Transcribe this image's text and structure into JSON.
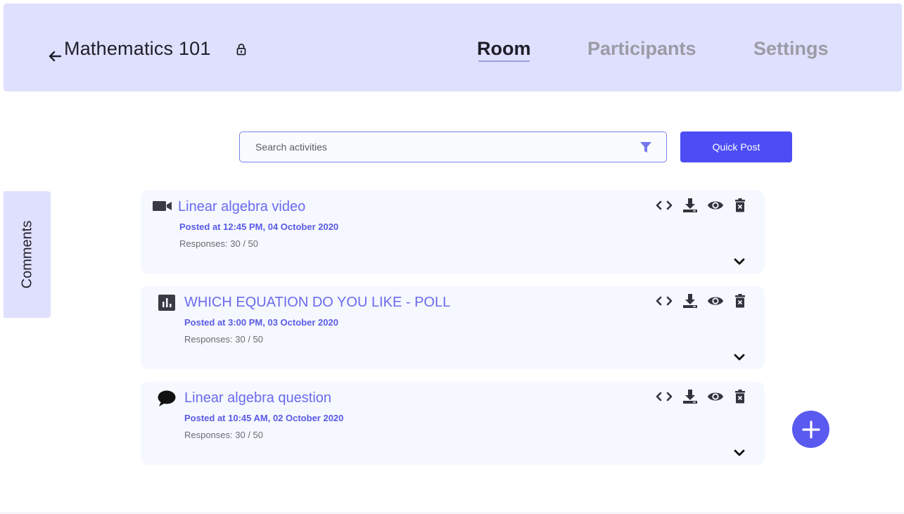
{
  "header": {
    "back_icon": "arrow-left-icon",
    "title": "Mathematics  101",
    "lock_icon": "lock-icon",
    "tabs": [
      {
        "label": "Room",
        "active": true
      },
      {
        "label": "Participants",
        "active": false
      },
      {
        "label": "Settings",
        "active": false
      }
    ]
  },
  "search": {
    "placeholder": "Search activities",
    "value": "",
    "filter_icon": "filter-icon"
  },
  "quick_post": {
    "label": "Quick Post"
  },
  "comments_tab": {
    "label": "Comments"
  },
  "activities": [
    {
      "type_icon": "video-icon",
      "title": "Linear algebra video",
      "posted": "Posted at 12:45 PM, 04 October 2020",
      "responses": "Responses: 30 / 50"
    },
    {
      "type_icon": "poll-chart-icon",
      "title": "WHICH EQUATION DO YOU LIKE - POLL",
      "posted": "Posted at 3:00 PM, 03 October 2020",
      "responses": "Responses: 30 / 50"
    },
    {
      "type_icon": "speech-bubble-icon",
      "title": "Linear algebra question",
      "posted": "Posted at 10:45 AM, 02 October 2020",
      "responses": "Responses: 30 / 50"
    }
  ],
  "card_action_icons": [
    "code-icon",
    "download-icon",
    "eye-icon",
    "delete-icon"
  ],
  "fab_icon": "plus-icon",
  "colors": {
    "header_bg": "#dfe0fd",
    "accent": "#4d4df5",
    "title_purple": "#6a6af0",
    "card_bg": "#f5f8fe"
  }
}
